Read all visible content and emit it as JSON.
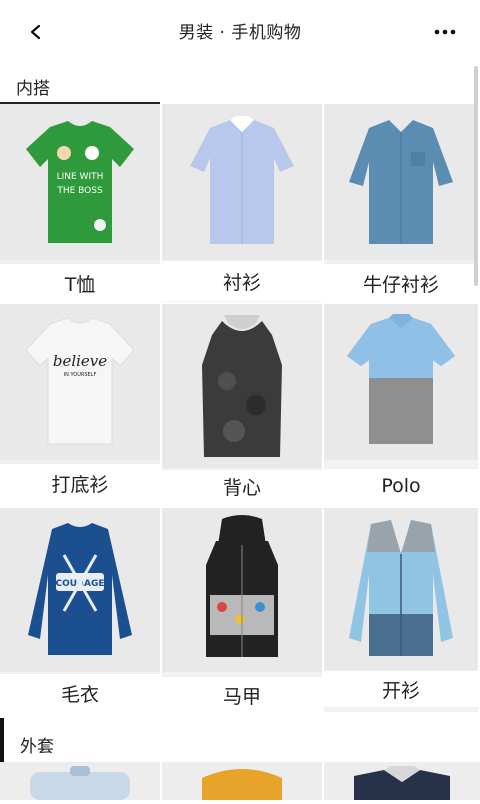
{
  "header": {
    "title": "男装 · 手机购物",
    "back_icon": "chevron-left-icon",
    "more_icon": "more-horizontal-icon"
  },
  "sections": [
    {
      "label": "内搭",
      "items": [
        {
          "label": "T恤",
          "image": "green-tshirt",
          "colors": [
            "#2f9a3b"
          ]
        },
        {
          "label": "衬衫",
          "image": "light-blue-shirt",
          "colors": [
            "#b8c8ec"
          ]
        },
        {
          "label": "牛仔衬衫",
          "image": "denim-shirt",
          "colors": [
            "#5b8db2"
          ]
        },
        {
          "label": "打底衫",
          "image": "white-tshirt",
          "colors": [
            "#f6f6f6"
          ]
        },
        {
          "label": "背心",
          "image": "camo-tank-top",
          "colors": [
            "#3b3b3b"
          ]
        },
        {
          "label": "Polo",
          "image": "polo-shirt",
          "colors": [
            "#8ec0e8",
            "#8f8f8f"
          ]
        },
        {
          "label": "毛衣",
          "image": "blue-sweater",
          "colors": [
            "#1c4f8f"
          ]
        },
        {
          "label": "马甲",
          "image": "hooded-vest",
          "colors": [
            "#222222"
          ]
        },
        {
          "label": "开衫",
          "image": "cardigan",
          "colors": [
            "#8fc4e3",
            "#4a6f8f"
          ]
        }
      ]
    },
    {
      "label": "外套",
      "items": [
        {
          "label": "",
          "image": "jacket-1",
          "colors": [
            "#c9d8e8"
          ]
        },
        {
          "label": "",
          "image": "jacket-2",
          "colors": [
            "#e8a42a"
          ]
        },
        {
          "label": "",
          "image": "jacket-3",
          "colors": [
            "#27314a"
          ]
        }
      ]
    }
  ]
}
